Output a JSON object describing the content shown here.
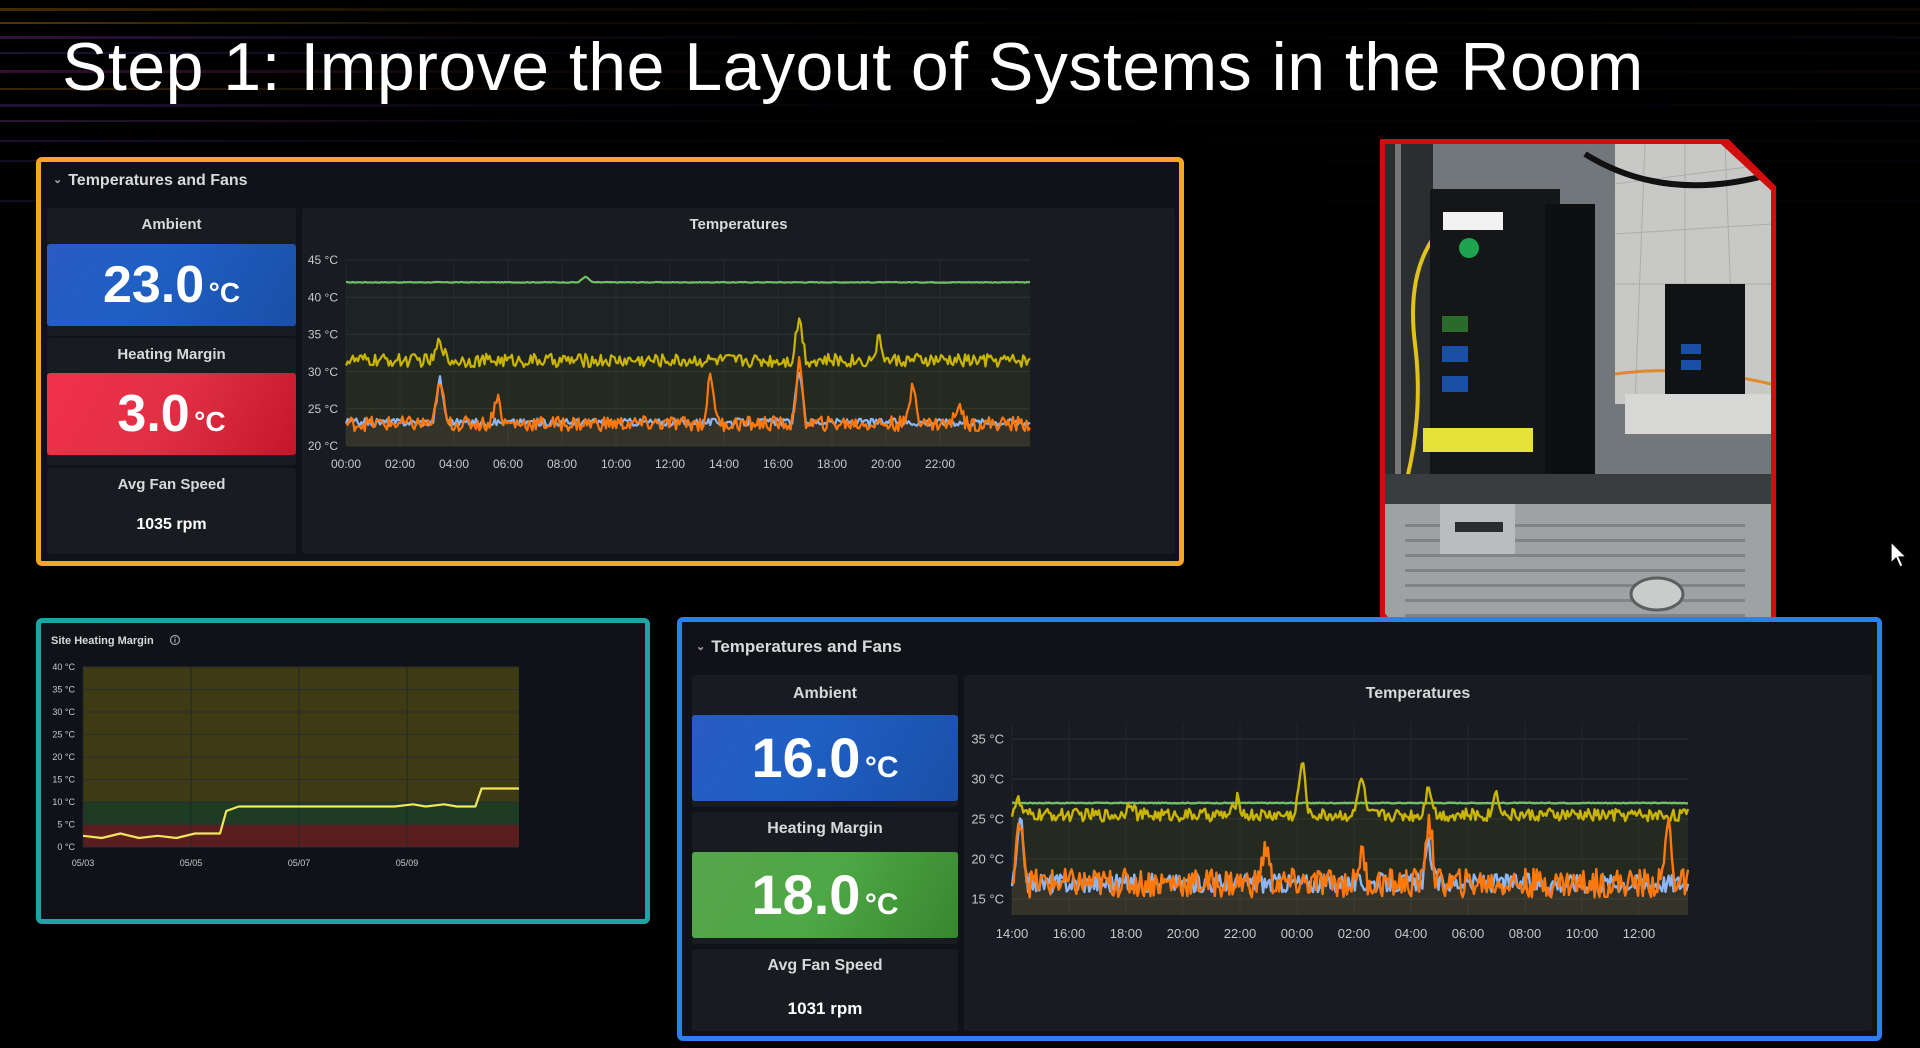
{
  "slide": {
    "title": "Step 1: Improve the Layout of Systems in the Room"
  },
  "dashboard_top": {
    "row_title": "Temperatures and Fans",
    "ambient": {
      "label": "Ambient",
      "value": "23.0",
      "unit": "°C"
    },
    "heating_margin": {
      "label": "Heating Margin",
      "value": "3.0",
      "unit": "°C"
    },
    "fan_speed": {
      "label": "Avg Fan Speed",
      "value": "1035 rpm"
    },
    "chart_title": "Temperatures"
  },
  "site_heating": {
    "title": "Site Heating Margin",
    "info_icon": "info-circle-icon"
  },
  "dashboard_bottom": {
    "row_title": "Temperatures and Fans",
    "ambient": {
      "label": "Ambient",
      "value": "16.0",
      "unit": "°C"
    },
    "heating_margin": {
      "label": "Heating Margin",
      "value": "18.0",
      "unit": "°C"
    },
    "fan_speed": {
      "label": "Avg Fan Speed",
      "value": "1031 rpm"
    },
    "chart_title": "Temperatures"
  },
  "photo": {
    "description_icon": "server-rack-photo"
  },
  "colors": {
    "orange_frame": "#f5a623",
    "teal_frame": "#1fa3a6",
    "blue_frame": "#2d7ef0",
    "red_frame": "#d20d0d",
    "series_green": "#73bf69",
    "series_yellow": "#c9b400",
    "series_orange": "#ff780a",
    "series_grey": "#8ab8ff"
  },
  "chart_data": [
    {
      "id": "top-temperatures",
      "type": "line",
      "title": "Temperatures",
      "y_ticks": [
        "20 °C",
        "25 °C",
        "30 °C",
        "35 °C",
        "40 °C",
        "45 °C"
      ],
      "ylim": [
        20,
        45
      ],
      "x_ticks": [
        "00:00",
        "02:00",
        "04:00",
        "06:00",
        "08:00",
        "10:00",
        "12:00",
        "14:00",
        "16:00",
        "18:00",
        "20:00",
        "22:00"
      ],
      "xlim": [
        0,
        24
      ],
      "series": [
        {
          "color": "#73bf69",
          "baseline": 42,
          "noise": 0.05,
          "spikes": [
            [
              8.4,
              0.8
            ]
          ]
        },
        {
          "color": "#c9b400",
          "baseline": 31.5,
          "noise": 0.9,
          "spikes": [
            [
              3.3,
              3
            ],
            [
              15.9,
              6
            ],
            [
              18.7,
              3
            ]
          ]
        },
        {
          "color": "#8ab8ff",
          "baseline": 23.2,
          "noise": 0.5,
          "spikes": [
            [
              3.3,
              6
            ],
            [
              15.9,
              7
            ]
          ]
        },
        {
          "color": "#ff780a",
          "baseline": 23.0,
          "noise": 1.0,
          "spikes": [
            [
              3.3,
              6
            ],
            [
              5.3,
              4
            ],
            [
              12.8,
              7
            ],
            [
              15.9,
              8
            ],
            [
              19.9,
              6
            ],
            [
              21.5,
              3
            ]
          ]
        }
      ]
    },
    {
      "id": "site-heating-margin",
      "type": "line",
      "title": "Site Heating Margin",
      "y_ticks": [
        "0 °C",
        "5 °C",
        "10 °C",
        "15 °C",
        "20 °C",
        "25 °C",
        "30 °C",
        "35 °C",
        "40 °C"
      ],
      "ylim": [
        0,
        40
      ],
      "x_ticks": [
        "05/03",
        "05/05",
        "05/07",
        "05/09"
      ],
      "xlim": [
        3,
        10
      ],
      "thresholds": [
        {
          "from": 0,
          "to": 5,
          "color": "#5a1e1e"
        },
        {
          "from": 5,
          "to": 10,
          "color": "#1e3b24"
        },
        {
          "from": 10,
          "to": 40,
          "color": "#3d3a14"
        }
      ],
      "series": [
        {
          "color": "#f2e55c",
          "points": [
            [
              3.0,
              2.5
            ],
            [
              3.3,
              2
            ],
            [
              3.6,
              3
            ],
            [
              3.9,
              2
            ],
            [
              4.2,
              2.5
            ],
            [
              4.5,
              2
            ],
            [
              4.8,
              3
            ],
            [
              5.0,
              3
            ],
            [
              5.2,
              3
            ],
            [
              5.3,
              8
            ],
            [
              5.5,
              9
            ],
            [
              5.7,
              9
            ],
            [
              6.0,
              9
            ],
            [
              6.5,
              9
            ],
            [
              7.0,
              9
            ],
            [
              7.5,
              9
            ],
            [
              8.0,
              9
            ],
            [
              8.3,
              9.5
            ],
            [
              8.5,
              9
            ],
            [
              8.8,
              9.5
            ],
            [
              9.0,
              9
            ],
            [
              9.3,
              9
            ],
            [
              9.4,
              13
            ],
            [
              9.7,
              13
            ],
            [
              10.0,
              13
            ]
          ]
        }
      ]
    },
    {
      "id": "bottom-temperatures",
      "type": "line",
      "title": "Temperatures",
      "y_ticks": [
        "15 °C",
        "20 °C",
        "25 °C",
        "30 °C",
        "35 °C"
      ],
      "ylim": [
        13,
        37
      ],
      "x_ticks": [
        "14:00",
        "16:00",
        "18:00",
        "20:00",
        "22:00",
        "00:00",
        "02:00",
        "04:00",
        "06:00",
        "08:00",
        "10:00",
        "12:00"
      ],
      "xlim": [
        0,
        24
      ],
      "series": [
        {
          "color": "#73bf69",
          "baseline": 27,
          "noise": 0.05,
          "spikes": []
        },
        {
          "color": "#c9b400",
          "baseline": 25.5,
          "noise": 0.8,
          "spikes": [
            [
              0.2,
              2
            ],
            [
              4.2,
              2
            ],
            [
              8.0,
              2
            ],
            [
              10.3,
              7
            ],
            [
              12.4,
              5
            ],
            [
              14.8,
              4
            ],
            [
              17.2,
              3
            ]
          ]
        },
        {
          "color": "#8ab8ff",
          "baseline": 17,
          "noise": 1.2,
          "spikes": [
            [
              0.3,
              8
            ],
            [
              14.8,
              5
            ]
          ]
        },
        {
          "color": "#ff780a",
          "baseline": 17,
          "noise": 1.8,
          "spikes": [
            [
              0.3,
              9
            ],
            [
              14.8,
              9
            ],
            [
              12.4,
              4
            ],
            [
              23.3,
              8
            ],
            [
              9.0,
              5
            ]
          ]
        }
      ]
    }
  ]
}
